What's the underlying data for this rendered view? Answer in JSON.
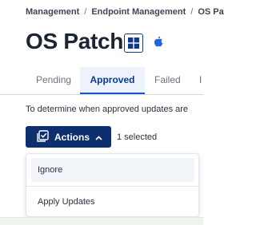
{
  "breadcrumb": {
    "items": [
      "Management",
      "Endpoint Management",
      "OS Pa"
    ],
    "separator": "/"
  },
  "page": {
    "title": "OS Patch",
    "platform_icons": [
      "windows-icon",
      "apple-icon"
    ]
  },
  "tabs": [
    {
      "label": "Pending",
      "active": false
    },
    {
      "label": "Approved",
      "active": true
    },
    {
      "label": "Failed",
      "active": false
    },
    {
      "label": "I",
      "active": false
    }
  ],
  "description": "To determine when approved updates are",
  "toolbar": {
    "actions_label": "Actions",
    "actions_icon": "checklist-icon",
    "selected_text": "1 selected"
  },
  "actions_menu": {
    "items": [
      {
        "label": "Ignore",
        "hovered": true
      },
      {
        "label": "Apply Updates",
        "hovered": false
      }
    ]
  },
  "colors": {
    "accent": "#0e2f6e",
    "active_tab_bg": "#edf2fb",
    "active_tab_underline": "#1752c7",
    "apple_icon": "#1f66e5"
  }
}
